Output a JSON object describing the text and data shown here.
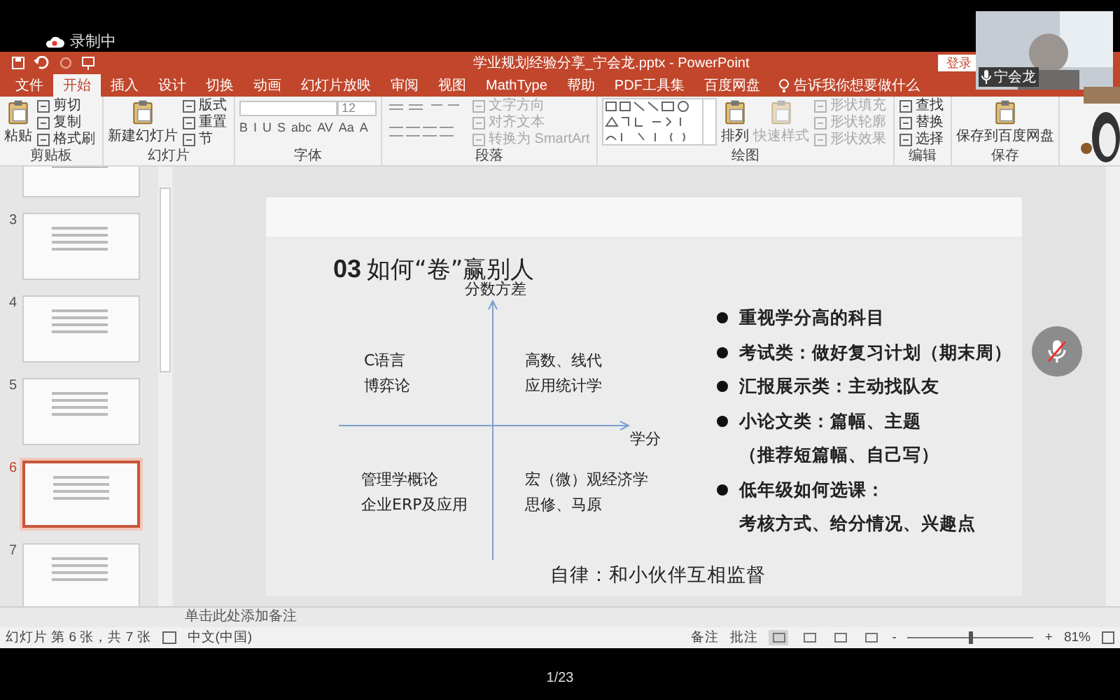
{
  "recording": {
    "label": "录制中"
  },
  "titlebar": {
    "title": "学业规划经验分享_宁会龙.pptx  -  PowerPoint",
    "login": "登录"
  },
  "tabs": [
    {
      "label": "文件",
      "selected": false
    },
    {
      "label": "开始",
      "selected": true
    },
    {
      "label": "插入",
      "selected": false
    },
    {
      "label": "设计",
      "selected": false
    },
    {
      "label": "切换",
      "selected": false
    },
    {
      "label": "动画",
      "selected": false
    },
    {
      "label": "幻灯片放映",
      "selected": false
    },
    {
      "label": "审阅",
      "selected": false
    },
    {
      "label": "视图",
      "selected": false
    },
    {
      "label": "MathType",
      "selected": false
    },
    {
      "label": "帮助",
      "selected": false
    },
    {
      "label": "PDF工具集",
      "selected": false
    },
    {
      "label": "百度网盘",
      "selected": false
    }
  ],
  "tell_me": {
    "placeholder": "告诉我你想要做什么"
  },
  "ribbon": {
    "groups": [
      {
        "label": "剪贴板",
        "items": [
          {
            "kind": "large",
            "label": "粘贴",
            "disabled": false
          },
          {
            "kind": "small",
            "label": "剪切",
            "disabled": false
          },
          {
            "kind": "small",
            "label": "复制",
            "disabled": false
          },
          {
            "kind": "small",
            "label": "格式刷",
            "disabled": false
          }
        ]
      },
      {
        "label": "幻灯片",
        "items": [
          {
            "kind": "large",
            "label": "新建幻灯片",
            "disabled": false
          },
          {
            "kind": "small",
            "label": "版式",
            "disabled": false
          },
          {
            "kind": "small",
            "label": "重置",
            "disabled": false
          },
          {
            "kind": "small",
            "label": "节",
            "disabled": false
          }
        ]
      },
      {
        "label": "字体",
        "items": [
          {
            "kind": "font"
          },
          {
            "kind": "size",
            "value": "12"
          },
          {
            "kind": "glyphs",
            "glyphs": [
              "B",
              "I",
              "U",
              "S",
              "abc",
              "AV",
              "Aa",
              "A"
            ]
          }
        ]
      },
      {
        "label": "段落",
        "items": [
          {
            "kind": "tools"
          },
          {
            "kind": "small",
            "label": "文字方向",
            "disabled": true
          },
          {
            "kind": "small",
            "label": "对齐文本",
            "disabled": true
          },
          {
            "kind": "small",
            "label": "转换为 SmartArt",
            "disabled": true
          }
        ]
      },
      {
        "label": "绘图",
        "items": [
          {
            "kind": "gallery"
          },
          {
            "kind": "large",
            "label": "排列",
            "disabled": false
          },
          {
            "kind": "large",
            "label": "快速样式",
            "disabled": true
          },
          {
            "kind": "small",
            "label": "形状填充",
            "disabled": true
          },
          {
            "kind": "small",
            "label": "形状轮廓",
            "disabled": true
          },
          {
            "kind": "small",
            "label": "形状效果",
            "disabled": true
          }
        ]
      },
      {
        "label": "编辑",
        "items": [
          {
            "kind": "small",
            "label": "查找",
            "disabled": false
          },
          {
            "kind": "small",
            "label": "替换",
            "disabled": false
          },
          {
            "kind": "small",
            "label": "选择",
            "disabled": false
          }
        ]
      },
      {
        "label": "保存",
        "items": [
          {
            "kind": "large",
            "label": "保存到百度网盘",
            "disabled": false
          }
        ]
      }
    ]
  },
  "video": {
    "name": "宁会龙"
  },
  "thumbnails": [
    {
      "selected": false
    },
    {
      "number": "3",
      "selected": false
    },
    {
      "number": "4",
      "selected": false
    },
    {
      "number": "5",
      "selected": false
    },
    {
      "number": "6",
      "selected": true
    },
    {
      "number": "7",
      "selected": false
    }
  ],
  "slide": {
    "title_number": "03",
    "title": "如何“卷”赢别人",
    "y_axis": "分数方差",
    "x_axis": "学分",
    "quadrants": [
      {
        "lines": [
          "C语言",
          "博弈论"
        ]
      },
      {
        "lines": [
          "高数、线代",
          "应用统计学"
        ]
      },
      {
        "lines": [
          "管理学概论",
          "企业ERP及应用"
        ]
      },
      {
        "lines": [
          "宏（微）观经济学",
          "思修、马原"
        ]
      }
    ],
    "bullets": [
      {
        "text": "重视学分高的科目"
      },
      {
        "text": "考试类：做好复习计划（期末周）"
      },
      {
        "text": "汇报展示类：主动找队友"
      },
      {
        "text": "小论文类：篇幅、主题",
        "continuation": "（推荐短篇幅、自己写）"
      },
      {
        "text": "低年级如何选课：",
        "continuation": "考核方式、给分情况、兴趣点"
      }
    ],
    "footer": "自律：和小伙伴互相监督"
  },
  "notes": {
    "placeholder": "单击此处添加备注"
  },
  "status_bar": {
    "slide_info": "幻灯片 第 6 张，共 7 张",
    "language": "中文(中国)",
    "notes": "备注",
    "comments": "批注",
    "views": [
      {
        "selected": true
      },
      {
        "selected": false
      },
      {
        "selected": false
      },
      {
        "selected": false
      }
    ],
    "zoom_out": "-",
    "zoom_slider": {
      "level": 0.5
    },
    "zoom_in": "+",
    "zoom": "81%"
  },
  "page_counter": "1/23"
}
